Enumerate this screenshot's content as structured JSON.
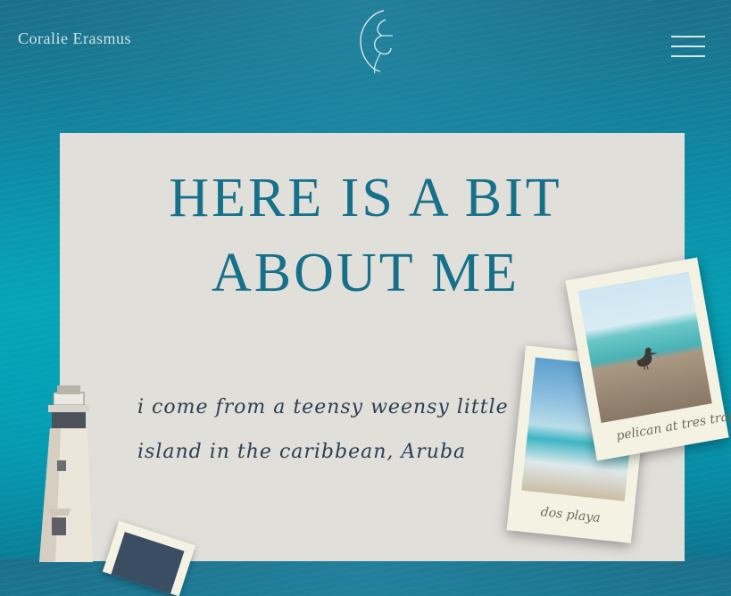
{
  "header": {
    "site_name": "Coralie Erasmus",
    "logo_icon": "ce-monogram-icon",
    "menu_icon": "hamburger-menu-icon"
  },
  "about": {
    "headline_line1": "HERE IS A BIT",
    "headline_line2": "ABOUT ME",
    "bio_line1": "i come from a teensy weensy little",
    "bio_line2": "island in the caribbean, Aruba"
  },
  "polaroids": [
    {
      "caption": "pelican at tres trap"
    },
    {
      "caption": "dos playa"
    }
  ],
  "colors": {
    "headline": "#16708a",
    "card_background": "#e0dfda",
    "ocean": "#0a9fb2"
  }
}
